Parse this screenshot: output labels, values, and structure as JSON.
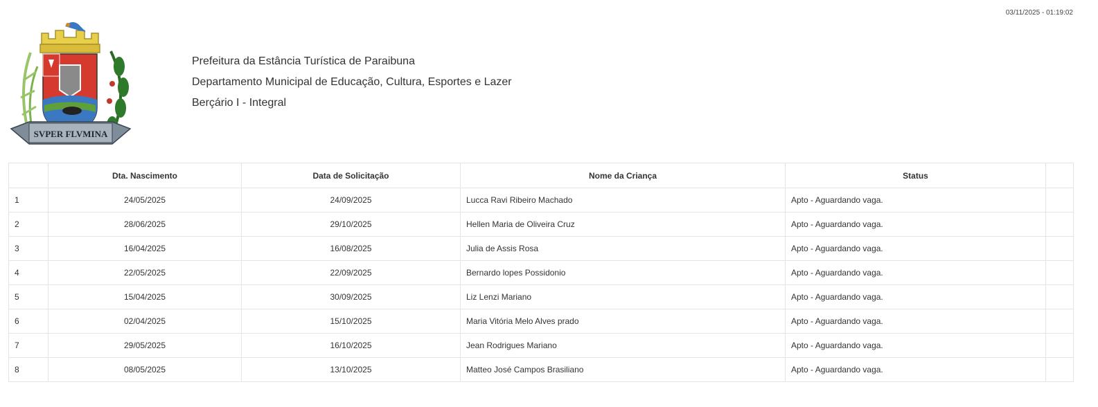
{
  "header": {
    "timestamp": "03/11/2025 - 01:19:02",
    "line1": "Prefeitura da Estância Turística de Paraibuna",
    "line2": "Departamento Municipal de Educação, Cultura, Esportes e Lazer",
    "line3": "Berçário I - Integral",
    "crest_motto": "SVPER FLVMINA",
    "crest_icon": "municipal-coat-of-arms"
  },
  "table": {
    "columns": [
      "",
      "Dta. Nascimento",
      "Data de Solicitação",
      "Nome da Criança",
      "Status",
      ""
    ],
    "rows": [
      {
        "idx": "1",
        "dob": "24/05/2025",
        "requested": "24/09/2025",
        "name": "Lucca Ravi Ribeiro Machado",
        "status": "Apto - Aguardando vaga."
      },
      {
        "idx": "2",
        "dob": "28/06/2025",
        "requested": "29/10/2025",
        "name": "Hellen Maria de Oliveira Cruz",
        "status": "Apto - Aguardando vaga."
      },
      {
        "idx": "3",
        "dob": "16/04/2025",
        "requested": "16/08/2025",
        "name": "Julia de Assis Rosa",
        "status": "Apto - Aguardando vaga."
      },
      {
        "idx": "4",
        "dob": "22/05/2025",
        "requested": "22/09/2025",
        "name": "Bernardo lopes Possidonio",
        "status": "Apto - Aguardando vaga."
      },
      {
        "idx": "5",
        "dob": "15/04/2025",
        "requested": "30/09/2025",
        "name": "Liz Lenzi Mariano",
        "status": "Apto - Aguardando vaga."
      },
      {
        "idx": "6",
        "dob": "02/04/2025",
        "requested": "15/10/2025",
        "name": "Maria Vitória Melo Alves prado",
        "status": "Apto - Aguardando vaga."
      },
      {
        "idx": "7",
        "dob": "29/05/2025",
        "requested": "16/10/2025",
        "name": "Jean Rodrigues Mariano",
        "status": "Apto - Aguardando vaga."
      },
      {
        "idx": "8",
        "dob": "08/05/2025",
        "requested": "13/10/2025",
        "name": "Matteo José Campos Brasiliano",
        "status": "Apto - Aguardando vaga."
      }
    ]
  },
  "colors": {
    "text": "#333333",
    "border": "#e4e4e4",
    "crest_red": "#d63a2f",
    "crest_gold": "#e8cf4a",
    "crest_green": "#2f7a2a",
    "crest_blue": "#3a78c2"
  }
}
